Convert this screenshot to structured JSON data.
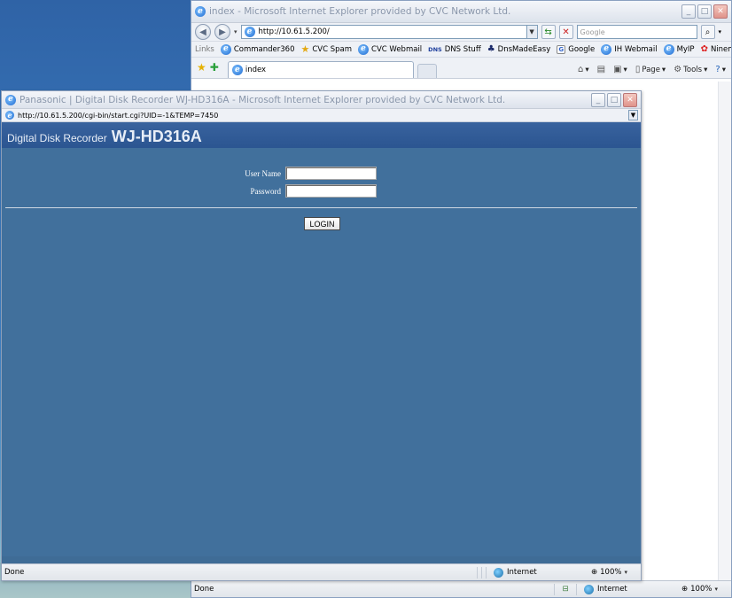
{
  "back_window": {
    "title": "index - Microsoft Internet Explorer provided by CVC Network Ltd.",
    "address": "http://10.61.5.200/",
    "search_placeholder": "Google",
    "links_label": "Links",
    "links": [
      "Commander360",
      "CVC Spam",
      "CVC Webmail",
      "DNS Stuff",
      "DnsMadeEasy",
      "Google",
      "IH Webmail",
      "MyIP",
      "Ninemsn"
    ],
    "dns_badge": "DNS",
    "tab_label": "index",
    "cmd_page": "Page",
    "cmd_tools": "Tools",
    "status_text": "Done",
    "zone": "Internet",
    "zoom": "100%"
  },
  "front_window": {
    "title": "Panasonic | Digital Disk Recorder WJ-HD316A - Microsoft Internet Explorer provided by CVC Network Ltd.",
    "address": "http://10.61.5.200/cgi-bin/start.cgi?UID=-1&TEMP=7450",
    "header_sub": "Digital Disk Recorder",
    "header_model": "WJ-HD316A",
    "username_label": "User Name",
    "username_value": "",
    "password_label": "Password",
    "password_value": "",
    "login_label": "LOGIN",
    "status_text": "Done",
    "zone": "Internet",
    "zoom": "100%"
  },
  "colors": {
    "page_bg": "#41709c",
    "header_bg": "#2b5591",
    "desktop": "#3d7fc4"
  }
}
